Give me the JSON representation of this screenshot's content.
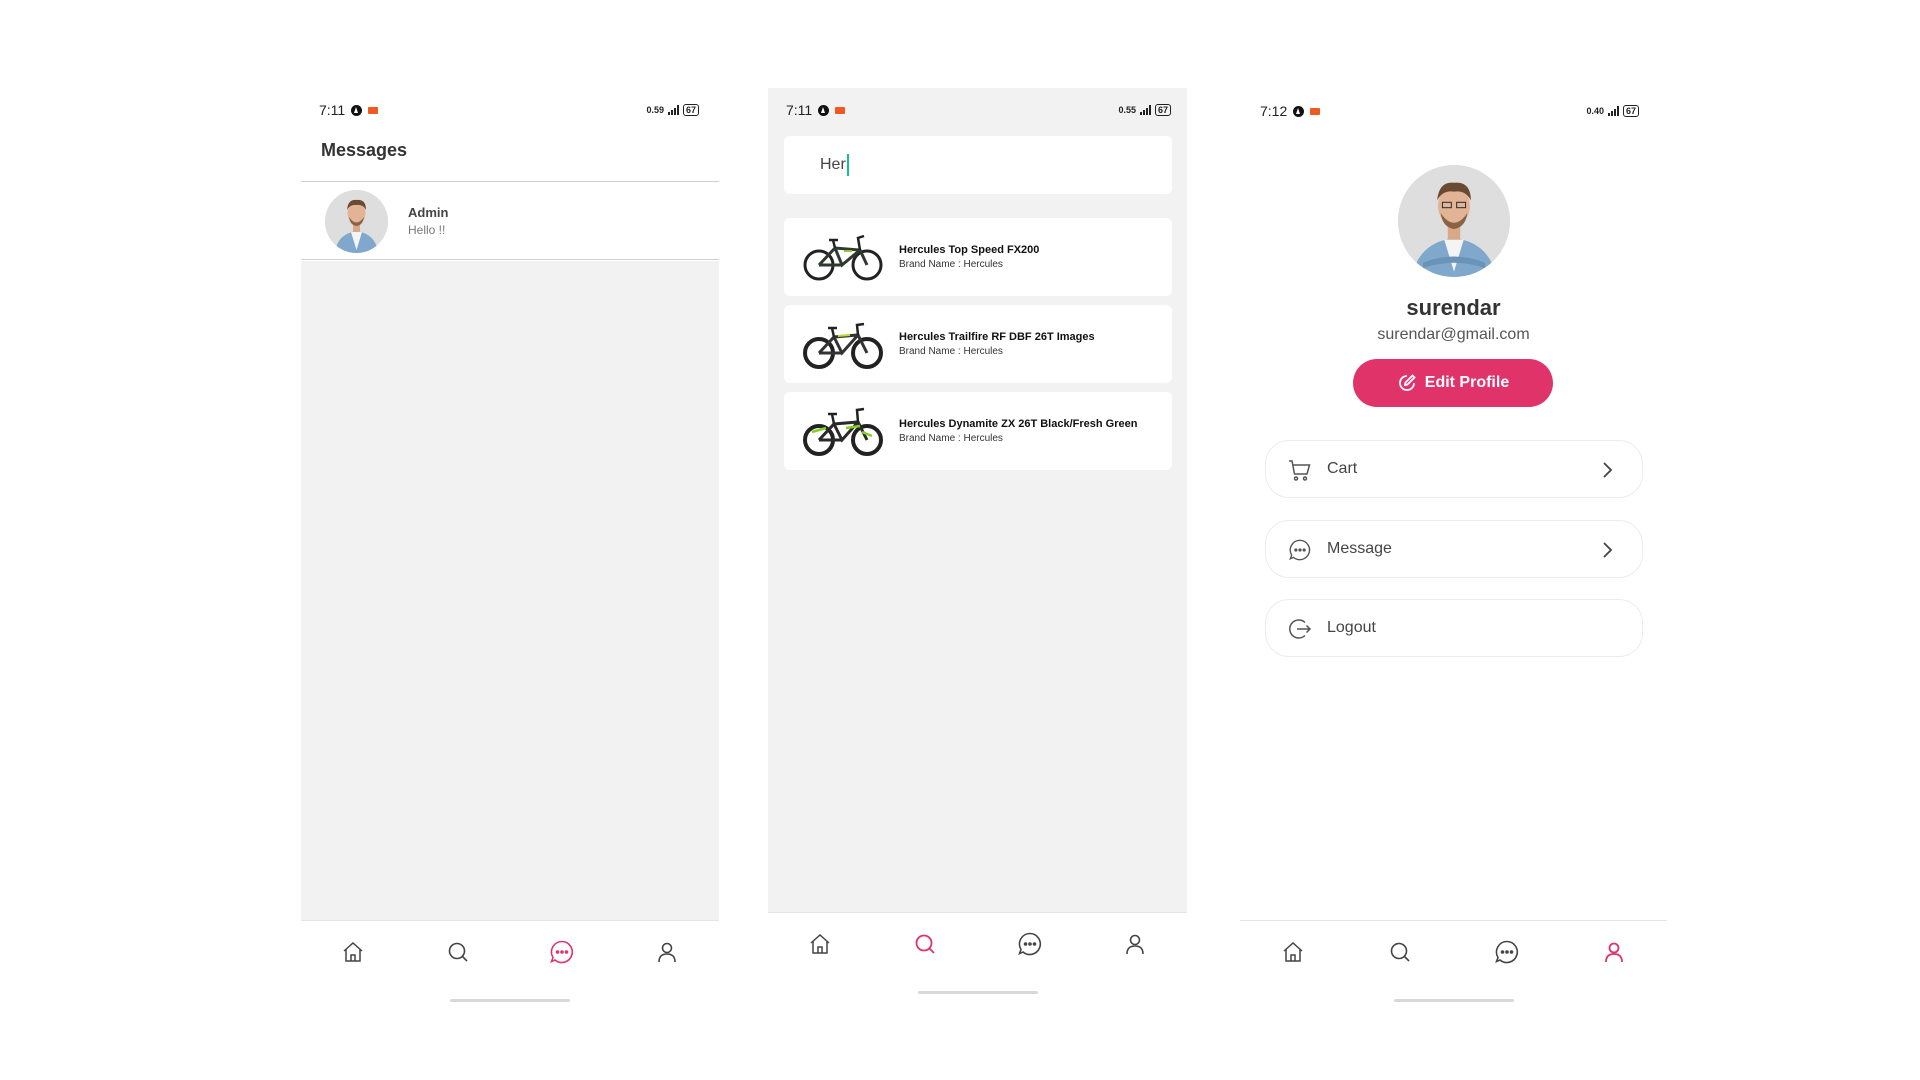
{
  "colors": {
    "accent": "#e0336a",
    "nav_inactive": "#444444",
    "screen_bg": "#f2f2f2"
  },
  "screens": [
    {
      "status_time": "7:11",
      "status_speed": "0.59",
      "status_battery": "67",
      "title": "Messages",
      "conversations": [
        {
          "name": "Admin",
          "message": "Hello !!"
        }
      ],
      "nav_active": "messages"
    },
    {
      "status_time": "7:11",
      "status_speed": "0.55",
      "status_battery": "67",
      "search_value": "Her",
      "results": [
        {
          "title": "Hercules Top Speed FX200",
          "subtitle": "Brand Name : Hercules"
        },
        {
          "title": "Hercules Trailfire RF DBF 26T Images",
          "subtitle": "Brand Name : Hercules"
        },
        {
          "title": "Hercules Dynamite ZX 26T Black/Fresh Green",
          "subtitle": "Brand Name : Hercules"
        }
      ],
      "nav_active": "search"
    },
    {
      "status_time": "7:12",
      "status_speed": "0.40",
      "status_battery": "67",
      "user_name": "surendar",
      "user_email": "surendar@gmail.com",
      "edit_label": "Edit Profile",
      "menu": [
        {
          "label": "Cart",
          "icon": "cart-icon"
        },
        {
          "label": "Message",
          "icon": "chat-bubble-icon"
        },
        {
          "label": "Logout",
          "icon": "logout-icon"
        }
      ],
      "nav_active": "profile"
    }
  ],
  "nav_icons": [
    "home-icon",
    "search-icon",
    "chat-bubble-icon",
    "user-icon"
  ]
}
